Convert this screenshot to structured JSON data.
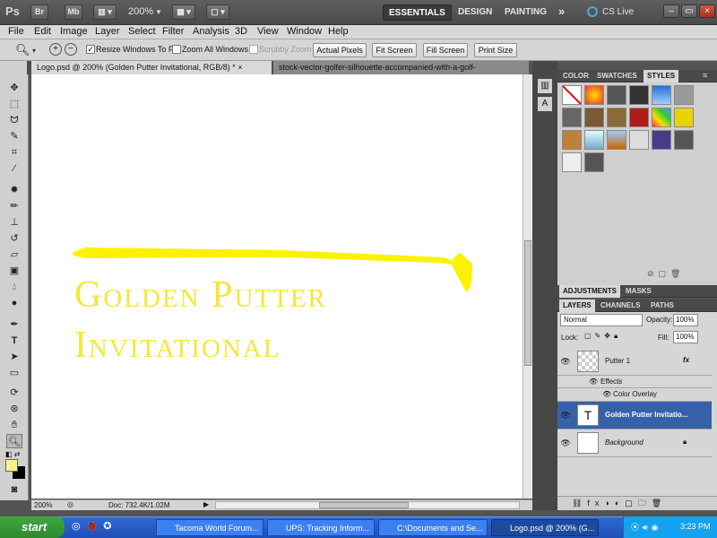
{
  "app": {
    "logo": "Ps",
    "br": "Br",
    "mb": "Mb",
    "zoom": "200%",
    "workspaces": [
      "ESSENTIALS",
      "DESIGN",
      "PAINTING"
    ],
    "more": "»",
    "cslive": "CS Live"
  },
  "menubar": [
    "File",
    "Edit",
    "Image",
    "Layer",
    "Select",
    "Filter",
    "Analysis",
    "3D",
    "View",
    "Window",
    "Help"
  ],
  "options": {
    "resize_windows": "Resize Windows To Fit",
    "zoom_all": "Zoom All Windows",
    "scrubby": "Scrubby Zoom",
    "actual_pixels": "Actual Pixels",
    "fit_screen": "Fit Screen",
    "fill_screen": "Fill Screen",
    "print_size": "Print Size"
  },
  "tabs": [
    {
      "label": "Logo.psd @ 200% (Golden Putter Invitational, RGB/8) *",
      "close": "×"
    },
    {
      "label": "stock-vector-golfer-silhouette-accompanied-with-a-golf-"
    }
  ],
  "canvas": {
    "line1": "Golden Putter",
    "line2": "Invitational",
    "text_color": "#f5e63c"
  },
  "status": {
    "zoom": "200%",
    "doc": "Doc: 732.4K/1.02M"
  },
  "panels": {
    "top_tabs": [
      "COLOR",
      "SWATCHES",
      "STYLES"
    ],
    "adj_tabs": [
      "ADJUSTMENTS",
      "MASKS"
    ],
    "layer_tabs": [
      "LAYERS",
      "CHANNELS",
      "PATHS"
    ],
    "blend_mode": "Normal",
    "opacity_label": "Opacity:",
    "opacity": "100%",
    "lock_label": "Lock:",
    "fill_label": "Fill:",
    "fill": "100%"
  },
  "layers": [
    {
      "name": "Putter 1",
      "fx": "fx"
    },
    {
      "name": "Effects"
    },
    {
      "name": "Color Overlay"
    },
    {
      "name": "Golden Putter Invitatio..."
    },
    {
      "name": "Background"
    }
  ],
  "taskbar": {
    "start": "start",
    "buttons": [
      "Tacoma World Forum...",
      "UPS: Tracking Inform...",
      "C:\\Documents and Se...",
      "Logo.psd @ 200% (G..."
    ],
    "clock": "3:23 PM"
  }
}
